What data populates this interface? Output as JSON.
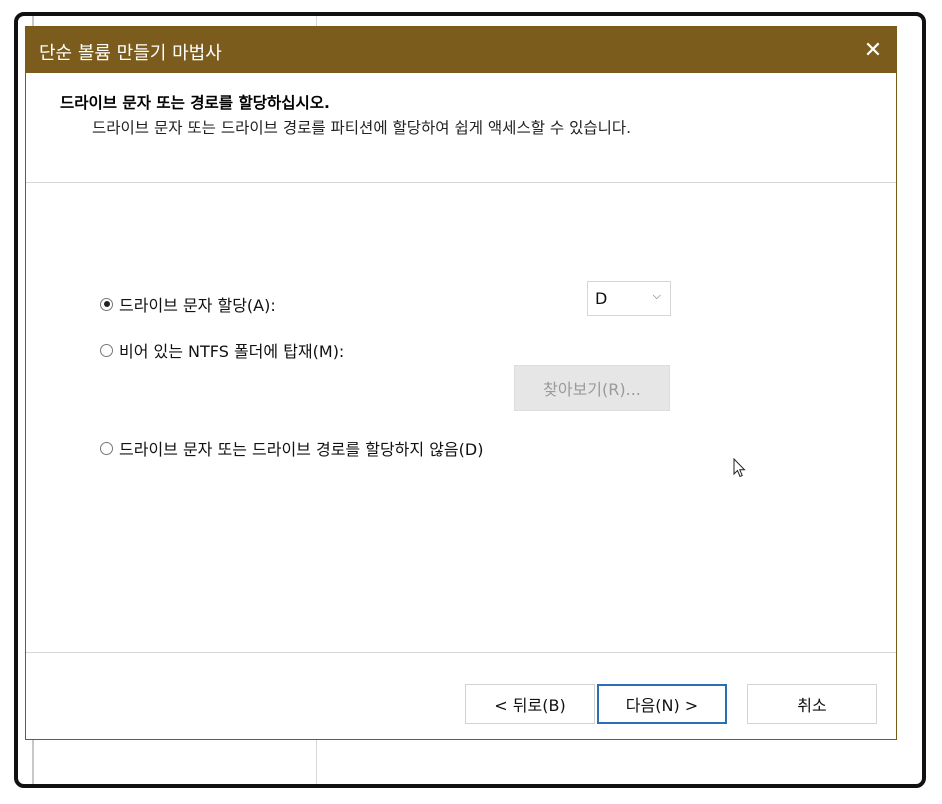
{
  "window": {
    "title": "단순 볼륨 만들기 마법사",
    "close_glyph": "✕"
  },
  "header": {
    "heading": "드라이브 문자 또는 경로를 할당하십시오.",
    "subheading": "드라이브 문자 또는 드라이브 경로를 파티션에 할당하여 쉽게 액세스할 수 있습니다."
  },
  "options": {
    "assign_letter": {
      "label": "드라이브 문자 할당(A):",
      "checked": true
    },
    "mount_folder": {
      "label": "비어 있는 NTFS 폴더에 탑재(M):",
      "checked": false
    },
    "no_assign": {
      "label": "드라이브 문자 또는 드라이브 경로를 할당하지 않음(D)",
      "checked": false
    }
  },
  "drive_select": {
    "value": "D",
    "chevron": "⌵"
  },
  "browse_button": {
    "label": "찾아보기(R)..."
  },
  "footer": {
    "back_label": "< 뒤로(B)",
    "next_label": "다음(N) >",
    "cancel_label": "취소"
  }
}
